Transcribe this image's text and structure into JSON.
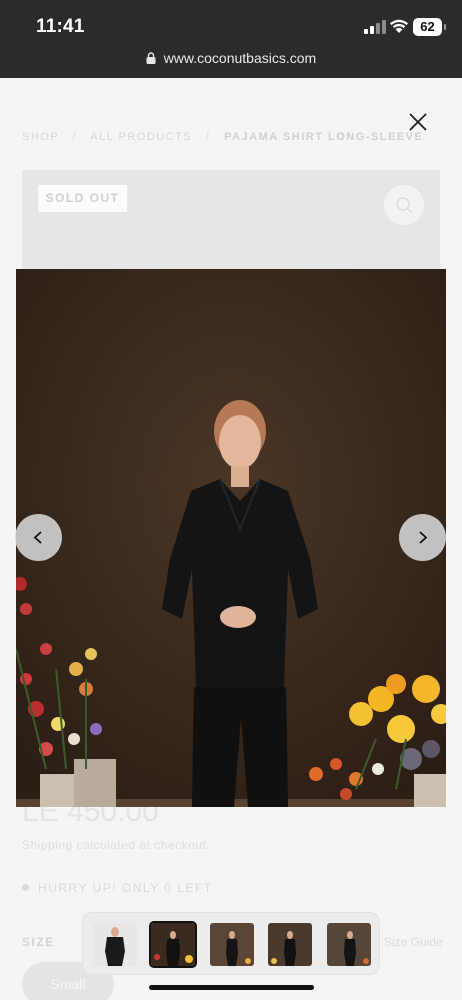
{
  "status_bar": {
    "time": "11:41",
    "battery": "62",
    "icons": [
      "cellular-signal-icon",
      "wifi-icon",
      "battery-icon"
    ]
  },
  "browser": {
    "url": "www.coconutbasics.com",
    "icons": [
      "lock-icon"
    ]
  },
  "page": {
    "breadcrumb": {
      "shop": "SHOP",
      "separator": "/",
      "all_products": "ALL PRODUCTS",
      "current": "PAJAMA SHIRT LONG-SLEEVE"
    },
    "badge": "SOLD OUT",
    "price": "LE 450.00",
    "shipping": "Shipping calculated at checkout.",
    "stock_notice": "HURRY UP! ONLY 0 LEFT",
    "size_label": "SIZE",
    "size_guide": "Size Guide",
    "size_option": "Small"
  },
  "lightbox": {
    "icons": [
      "close-icon",
      "chevron-left-icon",
      "chevron-right-icon",
      "search-icon"
    ],
    "thumbnails_count": 5,
    "active_thumbnail": 2
  },
  "colors": {
    "status_bar_bg": "#2a2b2d",
    "overlay_bg": "#f5f5f5",
    "photo_backdrop": "#3a2a1f",
    "garment": "#141414"
  }
}
